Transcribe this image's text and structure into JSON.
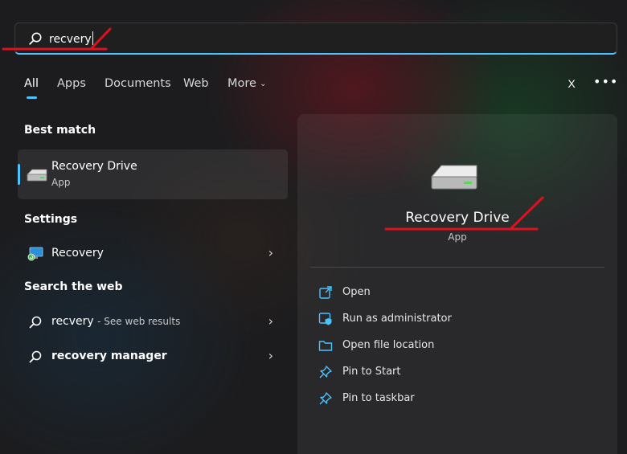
{
  "search": {
    "query": "recvery"
  },
  "tabs": [
    {
      "label": "All",
      "active": true
    },
    {
      "label": "Apps"
    },
    {
      "label": "Documents"
    },
    {
      "label": "Web"
    },
    {
      "label": "More"
    }
  ],
  "header": {
    "close_label": "X",
    "more_label": "•••"
  },
  "best_match": {
    "section": "Best match",
    "title": "Recovery Drive",
    "subtitle": "App",
    "icon": "drive-icon"
  },
  "settings": {
    "section": "Settings",
    "items": [
      {
        "label": "Recovery",
        "icon": "recovery-monitor-icon"
      }
    ]
  },
  "web": {
    "section": "Search the web",
    "items": [
      {
        "label": "recvery",
        "hint": "- See web results"
      },
      {
        "label": "recovery manager"
      }
    ]
  },
  "details": {
    "title": "Recovery Drive",
    "subtitle": "App",
    "actions": [
      {
        "label": "Open",
        "icon": "open-external-icon"
      },
      {
        "label": "Run as administrator",
        "icon": "shield-admin-icon"
      },
      {
        "label": "Open file location",
        "icon": "folder-icon"
      },
      {
        "label": "Pin to Start",
        "icon": "pin-icon"
      },
      {
        "label": "Pin to taskbar",
        "icon": "pin-icon"
      }
    ]
  },
  "colors": {
    "accent": "#4cc2ff",
    "annotation": "#e0101e",
    "background": "#1c1c1e"
  }
}
